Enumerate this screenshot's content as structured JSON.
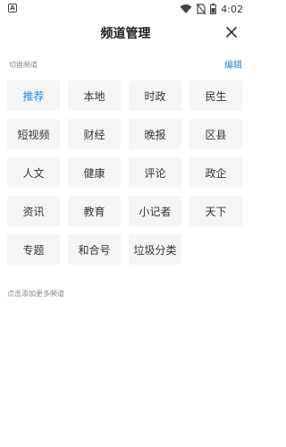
{
  "status_bar": {
    "time": "4:02"
  },
  "header": {
    "title": "频道管理"
  },
  "section": {
    "label": "切换频道",
    "edit_label": "编辑"
  },
  "channels": [
    {
      "label": "推荐",
      "active": true
    },
    {
      "label": "本地",
      "active": false
    },
    {
      "label": "时政",
      "active": false
    },
    {
      "label": "民生",
      "active": false
    },
    {
      "label": "短视频",
      "active": false
    },
    {
      "label": "财经",
      "active": false
    },
    {
      "label": "晚报",
      "active": false
    },
    {
      "label": "区县",
      "active": false
    },
    {
      "label": "人文",
      "active": false
    },
    {
      "label": "健康",
      "active": false
    },
    {
      "label": "评论",
      "active": false
    },
    {
      "label": "政企",
      "active": false
    },
    {
      "label": "资讯",
      "active": false
    },
    {
      "label": "教育",
      "active": false
    },
    {
      "label": "小记者",
      "active": false
    },
    {
      "label": "天下",
      "active": false
    },
    {
      "label": "专题",
      "active": false
    },
    {
      "label": "和合号",
      "active": false
    },
    {
      "label": "垃圾分类",
      "active": false
    }
  ],
  "more": {
    "hint": "点击添加更多频道"
  },
  "colors": {
    "accent": "#2a8ad6",
    "chip_bg": "#f5f5f5"
  }
}
